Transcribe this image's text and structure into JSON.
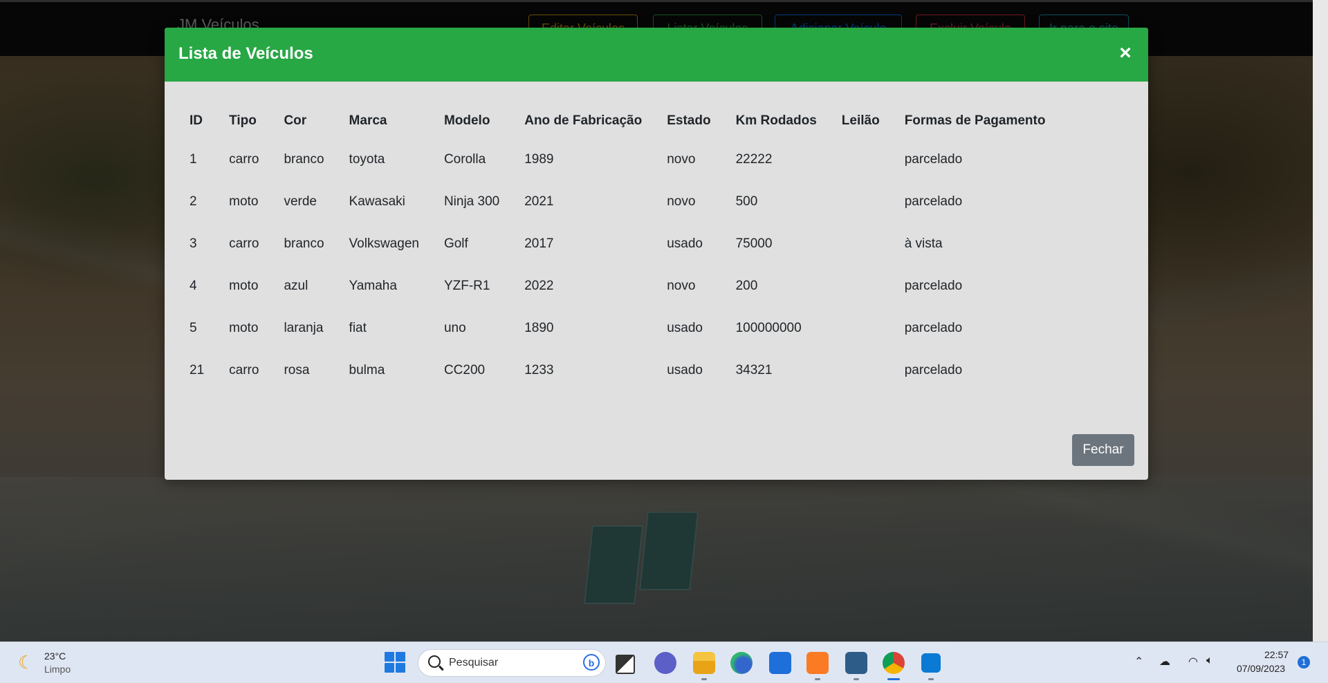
{
  "navbar": {
    "brand": "JM Veículos",
    "buttons": [
      {
        "label": "Editar Veículos",
        "color": "#d39e00"
      },
      {
        "label": "Listar Veículos",
        "color": "#28a745"
      },
      {
        "label": "Adicionar Veículo",
        "color": "#007bff"
      },
      {
        "label": "Excluir Veículo",
        "color": "#dc3545"
      },
      {
        "label": "Ir para o site",
        "color": "#17a2b8"
      }
    ]
  },
  "modal": {
    "title": "Lista de Veículos",
    "close_symbol": "×",
    "header_color": "#28a745",
    "columns": [
      "ID",
      "Tipo",
      "Cor",
      "Marca",
      "Modelo",
      "Ano de Fabricação",
      "Estado",
      "Km Rodados",
      "Leilão",
      "Formas de Pagamento"
    ],
    "rows": [
      [
        "1",
        "carro",
        "branco",
        "toyota",
        "Corolla",
        "1989",
        "novo",
        "22222",
        "",
        "parcelado"
      ],
      [
        "2",
        "moto",
        "verde",
        "Kawasaki",
        "Ninja 300",
        "2021",
        "novo",
        "500",
        "",
        "parcelado"
      ],
      [
        "3",
        "carro",
        "branco",
        "Volkswagen",
        "Golf",
        "2017",
        "usado",
        "75000",
        "",
        "à vista"
      ],
      [
        "4",
        "moto",
        "azul",
        "Yamaha",
        "YZF-R1",
        "2022",
        "novo",
        "200",
        "",
        "parcelado"
      ],
      [
        "5",
        "moto",
        "laranja",
        "fiat",
        "uno",
        "1890",
        "usado",
        "100000000",
        "",
        "parcelado"
      ],
      [
        "21",
        "carro",
        "rosa",
        "bulma",
        "CC200",
        "1233",
        "usado",
        "34321",
        "",
        "parcelado"
      ]
    ],
    "close_button_label": "Fechar"
  },
  "taskbar": {
    "weather": {
      "temperature": "23°C",
      "condition": "Limpo",
      "icon": "moon-icon"
    },
    "search_placeholder": "Pesquisar",
    "apps": [
      "task-view-icon",
      "teams-icon",
      "file-explorer-icon",
      "edge-icon",
      "store-icon",
      "xampp-icon",
      "mysql-workbench-icon",
      "chrome-icon",
      "vscode-icon"
    ],
    "clock": {
      "time": "22:57",
      "date": "07/09/2023"
    },
    "notification_count": "1"
  }
}
